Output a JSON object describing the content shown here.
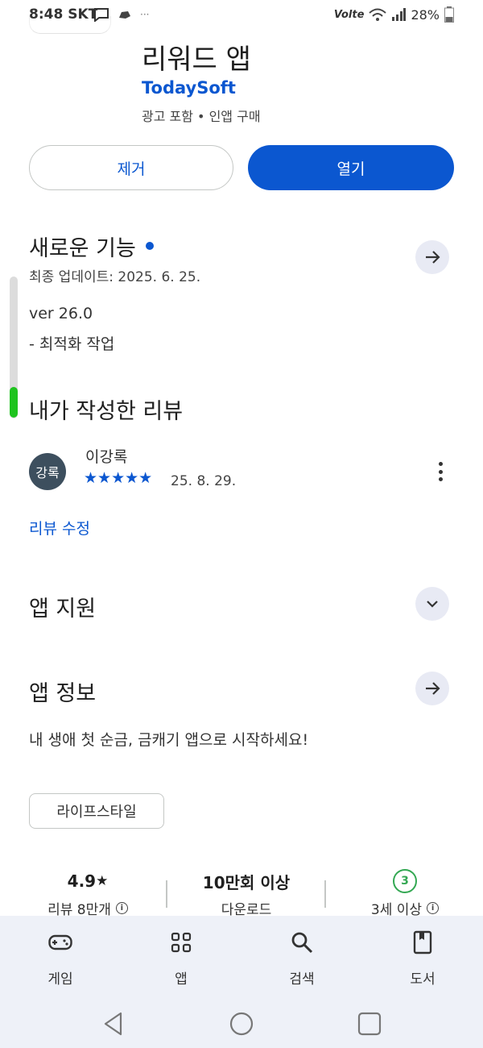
{
  "status_bar": {
    "time": "8:48",
    "carrier": "SKT",
    "battery": "28%",
    "network": "Volte"
  },
  "app": {
    "title": "리워드 앱",
    "developer": "TodaySoft",
    "meta": "광고 포함 • 인앱 구매"
  },
  "actions": {
    "uninstall_label": "제거",
    "open_label": "열기"
  },
  "whats_new": {
    "title": "새로운 기능",
    "updated": "최종 업데이트: 2025. 6. 25.",
    "version": "ver 26.0",
    "note": "- 최적화 작업"
  },
  "my_review": {
    "title": "내가 작성한 리뷰",
    "avatar_text": "강록",
    "name": "이강록",
    "stars": "★★★★★",
    "rating": 5,
    "date": "25. 8. 29.",
    "edit_label": "리뷰 수정"
  },
  "app_support": {
    "title": "앱 지원"
  },
  "app_info": {
    "title": "앱 정보",
    "description": "내 생애 첫 순금, 금캐기 앱으로 시작하세요!",
    "category": "라이프스타일"
  },
  "stats": {
    "rating_value": "4.9",
    "rating_star": "★",
    "rating_label": "리뷰 8만개",
    "downloads_value": "10만회 이상",
    "downloads_label": "다운로드",
    "age_value": "3",
    "age_label": "3세 이상"
  },
  "bottom_nav": [
    {
      "label": "게임",
      "icon": "gamepad-icon"
    },
    {
      "label": "앱",
      "icon": "apps-grid-icon"
    },
    {
      "label": "검색",
      "icon": "search-icon"
    },
    {
      "label": "도서",
      "icon": "book-icon"
    }
  ],
  "colors": {
    "accent": "#0b57d0",
    "nav_bg": "#eef1f8",
    "scroll_thumb": "#1ec31e",
    "age_badge": "#34a853"
  }
}
